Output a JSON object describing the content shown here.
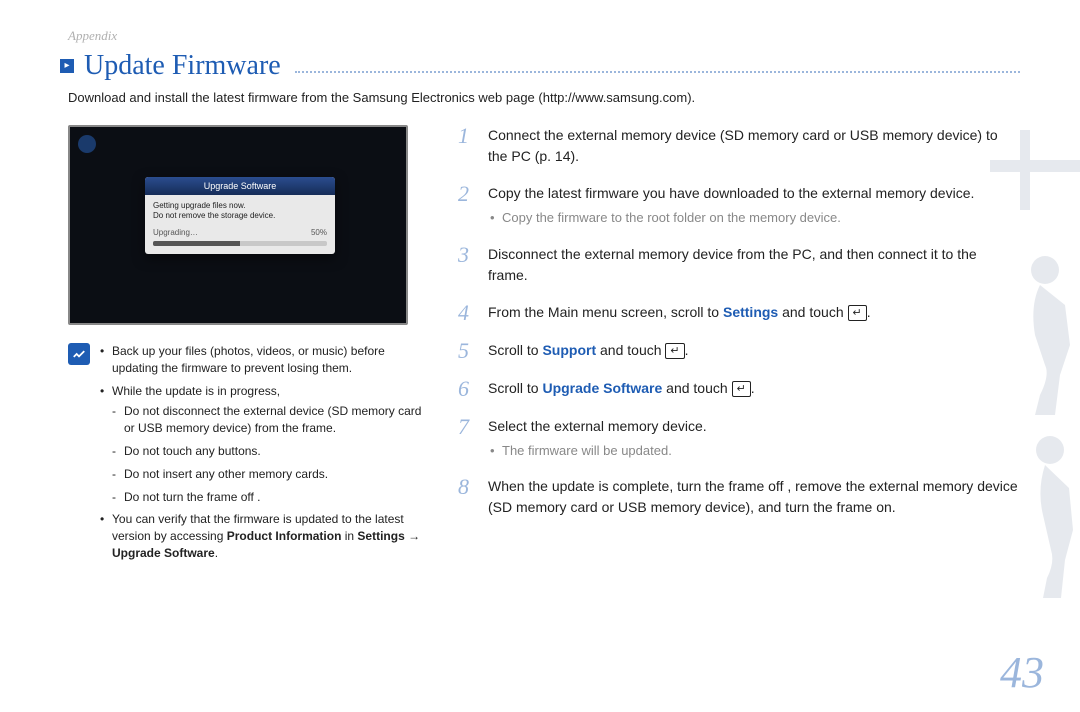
{
  "breadcrumb": "Appendix",
  "title": "Update Firmware",
  "intro": "Download and install the latest firmware from the Samsung Electronics web page (http://www.samsung.com).",
  "screenshot": {
    "panel_title": "Upgrade Software",
    "line1": "Getting upgrade files now.",
    "line2": "Do not remove the storage device.",
    "progress_label": "Upgrading…",
    "progress_pct": "50%"
  },
  "notes": {
    "n1": "Back up your files (photos, videos, or music) before updating the firmware to prevent losing them.",
    "n2": "While the update is in progress,",
    "n2a": "Do not disconnect the external device (SD memory card or USB memory device) from the frame.",
    "n2b": "Do not touch any buttons.",
    "n2c": "Do not insert any other memory cards.",
    "n2d": "Do not turn the frame off .",
    "n3_a": "You can verify that the firmware is updated to the latest version by accessing ",
    "n3_b": "Product Information",
    "n3_c": " in ",
    "n3_d": "Settings → Upgrade Software",
    "n3_e": "."
  },
  "steps": {
    "s1": "Connect the external memory device (SD memory card or USB memory device) to the PC (p. 14).",
    "s2": "Copy the latest firmware you have downloaded to the external memory device.",
    "s2_sub": "Copy the firmware to the root folder on the memory device.",
    "s3": "Disconnect the external memory device from the PC, and then connect it to the frame.",
    "s4_a": "From the Main menu screen, scroll to ",
    "s4_b": "Settings",
    "s4_c": " and touch ",
    "s5_a": "Scroll to ",
    "s5_b": "Support",
    "s5_c": " and touch ",
    "s6_a": "Scroll to ",
    "s6_b": "Upgrade Software",
    "s6_c": " and touch ",
    "s7": "Select the external memory device.",
    "s7_sub": "The firmware will be updated.",
    "s8": "When the update is complete, turn the frame off , remove the external memory device (SD memory card or USB memory device), and turn the frame on.",
    "enter_glyph": "↵"
  },
  "page_number": "43"
}
